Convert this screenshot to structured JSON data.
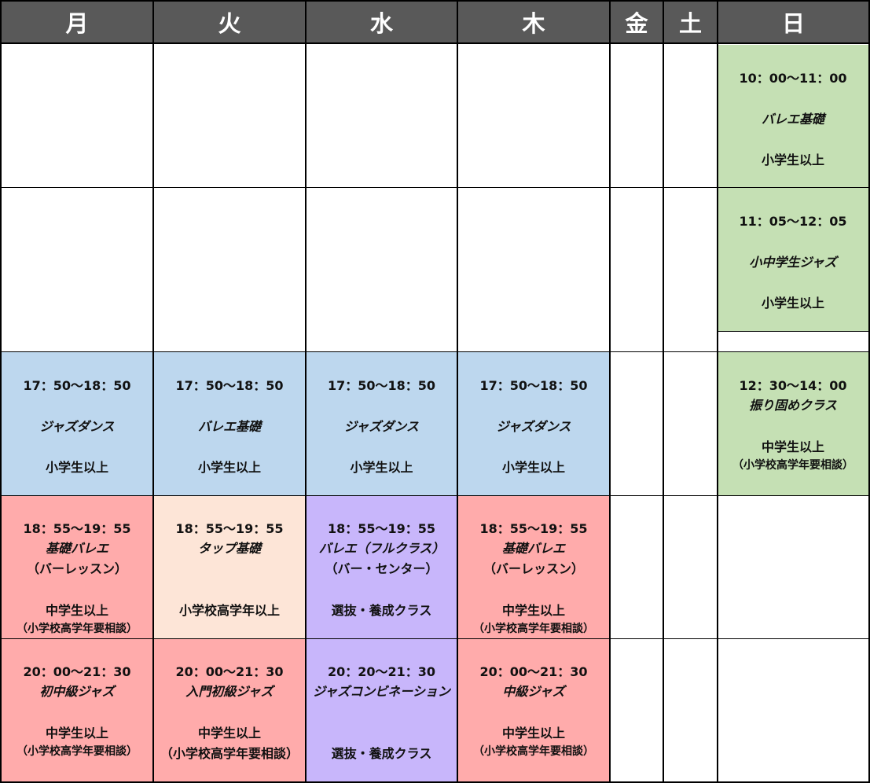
{
  "days": [
    "月",
    "火",
    "水",
    "木",
    "金",
    "土",
    "日"
  ],
  "colors": {
    "header": "#595959",
    "blue": "#bdd7ee",
    "green": "#c5e0b4",
    "red": "#ffabab",
    "peach": "#fde5d7",
    "purple": "#c8b6fb"
  },
  "classes": {
    "sun1": {
      "time": "10：00〜11：00",
      "name": "バレエ基礎",
      "target": "小学生以上"
    },
    "sun2": {
      "time": "11：05〜12：05",
      "name": "小中学生ジャズ",
      "target": "小学生以上"
    },
    "sun3": {
      "time": "12：30〜14：00",
      "name": "振り固めクラス",
      "target": "中学生以上",
      "note": "（小学校高学年要相談）"
    },
    "mon1": {
      "time": "17：50〜18：50",
      "name": "ジャズダンス",
      "target": "小学生以上"
    },
    "tue1": {
      "time": "17：50〜18：50",
      "name": "バレエ基礎",
      "target": "小学生以上"
    },
    "wed1": {
      "time": "17：50〜18：50",
      "name": "ジャズダンス",
      "target": "小学生以上"
    },
    "thu1": {
      "time": "17：50〜18：50",
      "name": "ジャズダンス",
      "target": "小学生以上"
    },
    "mon2": {
      "time": "18：55〜19：55",
      "name": "基礎バレエ",
      "name2": "（バーレッスン）",
      "target": "中学生以上",
      "note": "（小学校高学年要相談）"
    },
    "tue2": {
      "time": "18：55〜19：55",
      "name": "タップ基礎",
      "target": "小学校高学年以上"
    },
    "wed2": {
      "time": "18：55〜19：55",
      "name": "バレエ（フルクラス）",
      "name2": "（バー・センター）",
      "target": "選抜・養成クラス"
    },
    "thu2": {
      "time": "18：55〜19：55",
      "name": "基礎バレエ",
      "name2": "（バーレッスン）",
      "target": "中学生以上",
      "note": "（小学校高学年要相談）"
    },
    "mon3": {
      "time": "20：00〜21：30",
      "name": "初中級ジャズ",
      "target": "中学生以上",
      "note": "（小学校高学年要相談）"
    },
    "tue3": {
      "time": "20：00〜21：30",
      "name": "入門初級ジャズ",
      "target": "中学生以上",
      "note": "（小学校高学年要相談）"
    },
    "wed3": {
      "time": "20：20〜21：30",
      "name": "ジャズコンビネーション",
      "target": "選抜・養成クラス"
    },
    "thu3": {
      "time": "20：00〜21：30",
      "name": "中級ジャズ",
      "target": "中学生以上",
      "note": "（小学校高学年要相談）"
    }
  }
}
